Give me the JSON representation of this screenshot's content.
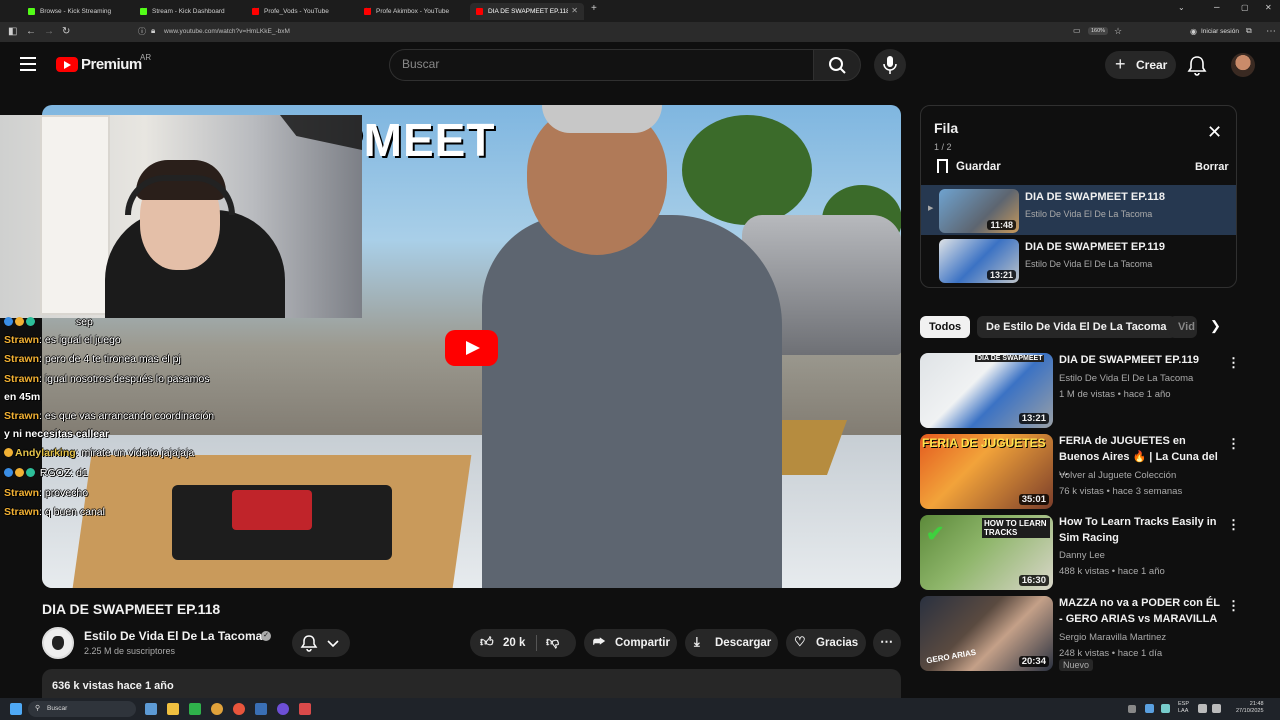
{
  "browser": {
    "tabs": [
      {
        "label": "Browse - Kick Streaming",
        "color": "#53fc18"
      },
      {
        "label": "Stream - Kick Dashboard",
        "color": "#53fc18"
      },
      {
        "label": "Profe_Vods - YouTube",
        "color": "#ff0000"
      },
      {
        "label": "Profe Akimbox - YouTube",
        "color": "#ff0000"
      },
      {
        "label": "DIA DE SWAPMEET EP.118 - Yo",
        "color": "#ff0000"
      }
    ],
    "url": "www.youtube.com/watch?v=HmLKkE_-bxM",
    "zoom": "160%",
    "signin": "Iniciar sesión"
  },
  "header": {
    "logo_text": "Premium",
    "country": "AR",
    "search_placeholder": "Buscar",
    "create_label": "Crear"
  },
  "player": {
    "thumbnail_text": "PMEET"
  },
  "chat": [
    {
      "user": "",
      "msg": "sep"
    },
    {
      "user": "Strawn",
      "msg": ": es igual el juego"
    },
    {
      "user": "Strawn",
      "msg": ": pero de 4 te tironea mas el pj"
    },
    {
      "user": "Strawn",
      "msg": ": igual nosotros después lo pasamos"
    },
    {
      "user": "",
      "msg": "en 45m"
    },
    {
      "user": "Strawn",
      "msg": ": es que vas arrancando coordinación"
    },
    {
      "user": "",
      "msg": "y ni necesitas callear"
    },
    {
      "user": "Andylarking",
      "msg": ": mirate un videito jajajaja"
    },
    {
      "user": "",
      "msg": "RGOZ: d1"
    },
    {
      "user": "Strawn",
      "msg": ": provecho"
    },
    {
      "user": "Strawn",
      "msg": ": q buen canal"
    }
  ],
  "video": {
    "title": "DIA DE SWAPMEET EP.118",
    "channel": "Estilo De Vida El De La Tacoma",
    "subscribers": "2.25 M de suscriptores",
    "likes": "20 k",
    "share": "Compartir",
    "download": "Descargar",
    "thanks": "Gracias",
    "views_date": "636 k vistas  hace 1 año"
  },
  "queue": {
    "title": "Fila",
    "count": "1 / 2",
    "save": "Guardar",
    "clear": "Borrar",
    "items": [
      {
        "title": "DIA DE SWAPMEET EP.118",
        "channel": "Estilo De Vida El De La Tacoma",
        "duration": "11:48"
      },
      {
        "title": "DIA DE SWAPMEET EP.119",
        "channel": "Estilo De Vida El De La Tacoma",
        "duration": "13:21"
      }
    ]
  },
  "chips": [
    "Todos",
    "De Estilo De Vida El De La Tacoma",
    "Vid"
  ],
  "recommendations": [
    {
      "title": "DIA DE SWAPMEET EP.119",
      "channel": "Estilo De Vida El De La Tacoma",
      "meta": "1 M de vistas • hace 1 año",
      "duration": "13:21",
      "thumb_text": "DIA DE SWAPMEET"
    },
    {
      "title": "FERIA de JUGUETES en Buenos Aires 🔥 | La Cuna del ...",
      "channel": "Volver al Juguete Colección",
      "meta": "76 k vistas • hace 3 semanas",
      "duration": "35:01",
      "thumb_text": "FERIA DE JUGUETES"
    },
    {
      "title": "How To Learn Tracks Easily in Sim Racing",
      "channel": "Danny Lee",
      "meta": "488 k vistas • hace 1 año",
      "duration": "16:30",
      "thumb_text": "HOW TO LEARN TRACKS"
    },
    {
      "title": "MAZZA no va a PODER con ÉL - GERO ARIAS vs MARAVILLA",
      "channel": "Sergio Maravilla Martinez",
      "meta": "248 k vistas • hace 1 día",
      "duration": "20:34",
      "thumb_text": "GERO ARIAS",
      "badge": "Nuevo"
    }
  ],
  "taskbar": {
    "search": "Buscar",
    "lang1": "ESP",
    "lang2": "LAA",
    "time": "21:48",
    "date": "27/10/2025"
  }
}
